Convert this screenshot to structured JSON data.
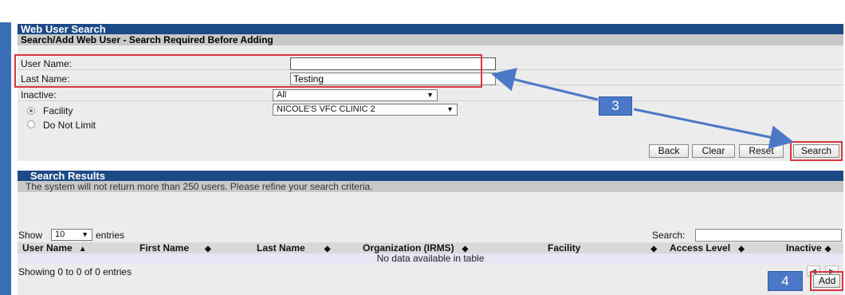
{
  "header": {
    "title": "Web User Search",
    "subtitle": "Search/Add Web User - Search Required Before Adding"
  },
  "form": {
    "user_name_label": "User Name:",
    "user_name_value": "",
    "last_name_label": "Last Name:",
    "last_name_value": "Testing",
    "inactive_label": "Inactive:",
    "inactive_selected": "All",
    "facility_label": "Facility",
    "facility_selected": "NICOLE'S VFC CLINIC 2",
    "do_not_limit_label": "Do Not Limit",
    "facility_radio_selected": true
  },
  "buttons": {
    "back": "Back",
    "clear": "Clear",
    "reset": "Reset",
    "search": "Search",
    "add": "Add"
  },
  "results": {
    "title": "Search Results",
    "notice": "The system will not return more than 250 users. Please refine your search criteria.",
    "show_label": "Show",
    "entries_label": "entries",
    "page_length": "10",
    "search_label": "Search:",
    "search_value": "",
    "columns": [
      "User Name",
      "First Name",
      "Last Name",
      "Organization (IRMS)",
      "Facility",
      "Access Level",
      "Inactive"
    ],
    "empty_message": "No data available in table",
    "info": "Showing 0 to 0 of 0 entries"
  },
  "callouts": {
    "step3": "3",
    "step4": "4"
  },
  "colors": {
    "header_blue": "#1c4a86",
    "callout_blue": "#4b78c7",
    "highlight_red": "#d9363e",
    "frame_blue": "#3a6fb5"
  }
}
